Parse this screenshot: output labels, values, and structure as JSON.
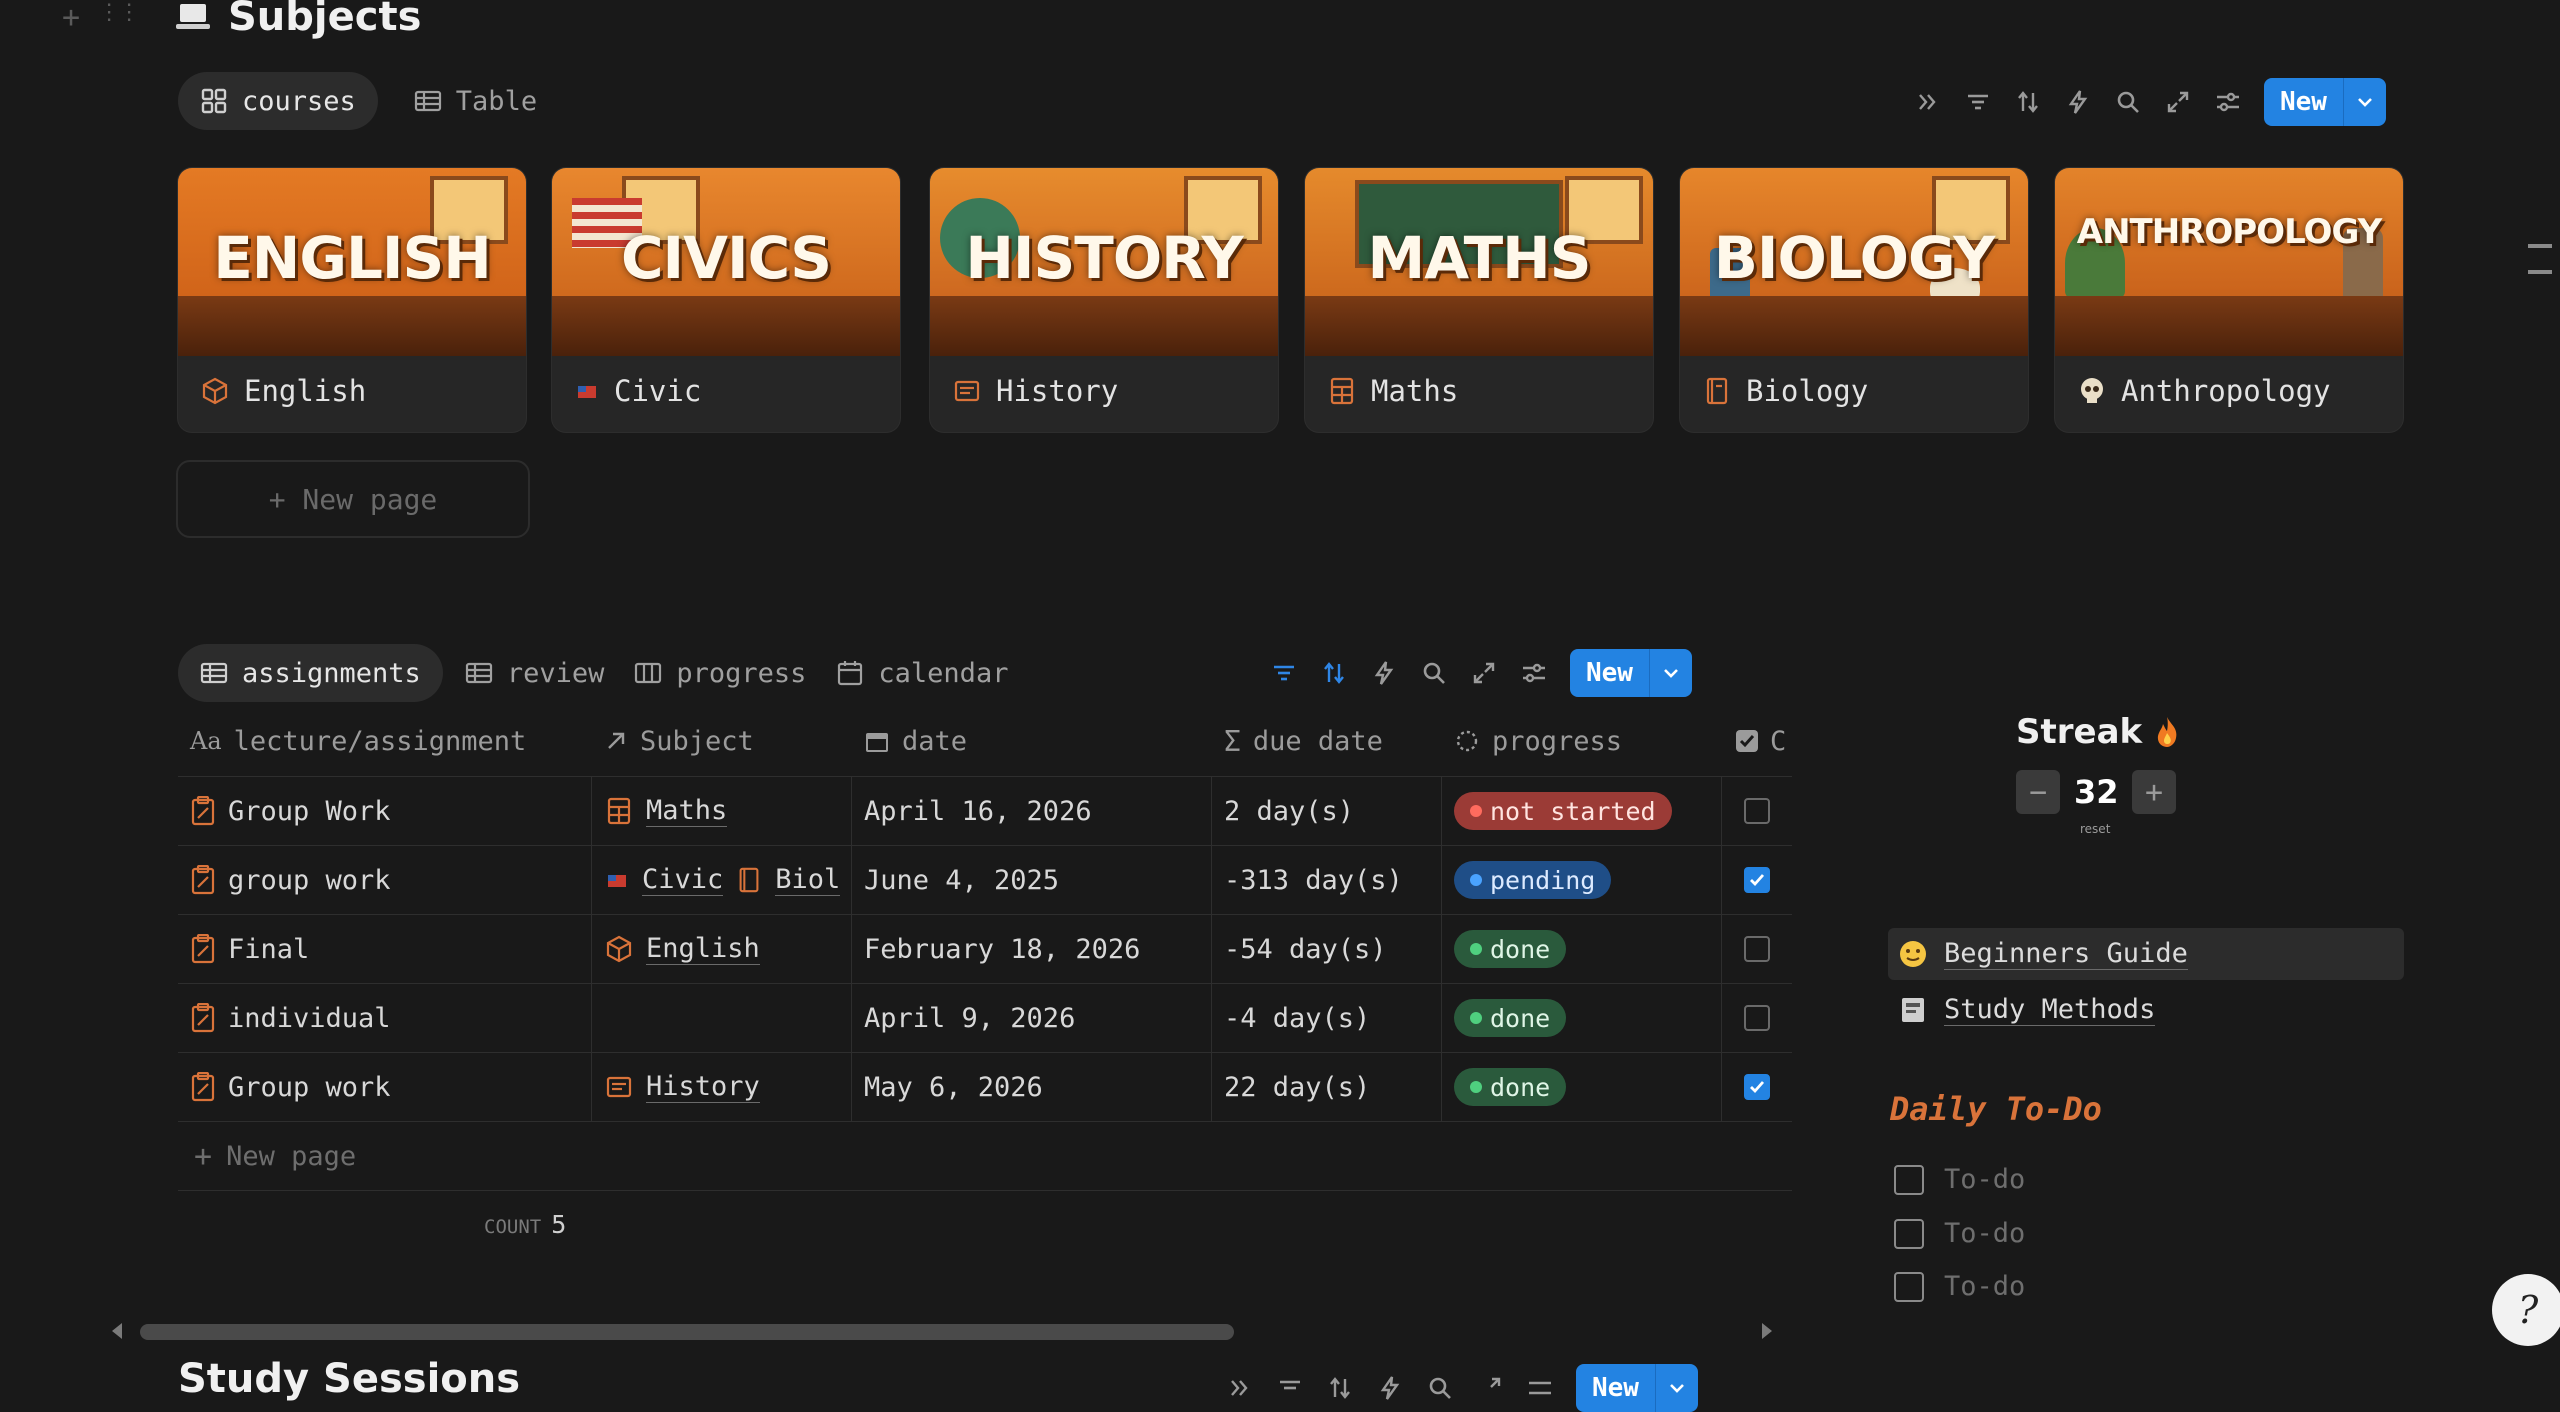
{
  "page": {
    "title": "Subjects"
  },
  "courses_view": {
    "tabs": [
      {
        "label": "courses",
        "active": true
      },
      {
        "label": "Table",
        "active": false
      }
    ],
    "new_label": "New",
    "cards": [
      {
        "cover_text": "ENGLISH",
        "name": "English",
        "icon": "cube-icon"
      },
      {
        "cover_text": "CIVICS",
        "name": "Civic",
        "icon": "flag-icon"
      },
      {
        "cover_text": "HISTORY",
        "name": "History",
        "icon": "scroll-icon"
      },
      {
        "cover_text": "MATHS",
        "name": "Maths",
        "icon": "calculator-icon"
      },
      {
        "cover_text": "BIOLOGY",
        "name": "Biology",
        "icon": "notebook-icon"
      },
      {
        "cover_text": "ANTHROPOLOGY",
        "name": "Anthropology",
        "icon": "skull-icon"
      }
    ],
    "new_page_label": "+ New page"
  },
  "assignments_view": {
    "tabs": [
      {
        "label": "assignments",
        "active": true
      },
      {
        "label": "review",
        "active": false
      },
      {
        "label": "progress",
        "active": false
      },
      {
        "label": "calendar",
        "active": false
      }
    ],
    "new_label": "New",
    "columns": [
      "lecture/assignment",
      "Subject",
      "date",
      "due date",
      "progress",
      "C"
    ],
    "rows": [
      {
        "name": "Group Work",
        "subjects": [
          {
            "name": "Maths",
            "icon": "calculator-icon"
          }
        ],
        "date": "April 16, 2026",
        "due": "2 day(s)",
        "progress": "not started",
        "status": "red",
        "checked": false
      },
      {
        "name": "group work",
        "subjects": [
          {
            "name": "Civic",
            "icon": "flag-icon"
          },
          {
            "name": "Biol",
            "icon": "notebook-icon"
          }
        ],
        "date": "June 4, 2025",
        "due": "-313 day(s)",
        "progress": "pending",
        "status": "blue",
        "checked": true
      },
      {
        "name": "Final",
        "subjects": [
          {
            "name": "English",
            "icon": "cube-icon"
          }
        ],
        "date": "February 18, 2026",
        "due": "-54 day(s)",
        "progress": "done",
        "status": "green",
        "checked": false
      },
      {
        "name": "individual",
        "subjects": [],
        "date": "April 9, 2026",
        "due": "-4 day(s)",
        "progress": "done",
        "status": "green",
        "checked": false
      },
      {
        "name": "Group work",
        "subjects": [
          {
            "name": "History",
            "icon": "scroll-icon"
          }
        ],
        "date": "May 6, 2026",
        "due": "22 day(s)",
        "progress": "done",
        "status": "green",
        "checked": true
      }
    ],
    "new_page_label": "New page",
    "count_label": "COUNT",
    "count_value": "5"
  },
  "streak": {
    "title": "Streak",
    "value": "32",
    "minus": "−",
    "plus": "+",
    "reset_label": "reset"
  },
  "links": [
    {
      "label": "Beginners Guide",
      "icon": "smiley-icon",
      "highlighted": true
    },
    {
      "label": "Study Methods",
      "icon": "notebook-icon",
      "highlighted": false
    }
  ],
  "daily_todo": {
    "title": "Daily To-Do",
    "items": [
      "To-do",
      "To-do",
      "To-do"
    ]
  },
  "next_section": {
    "title": "Study Sessions",
    "new_label": "New"
  },
  "colors": {
    "accent": "#2383e2",
    "background": "#191919",
    "daily_title": "#d9733a"
  }
}
